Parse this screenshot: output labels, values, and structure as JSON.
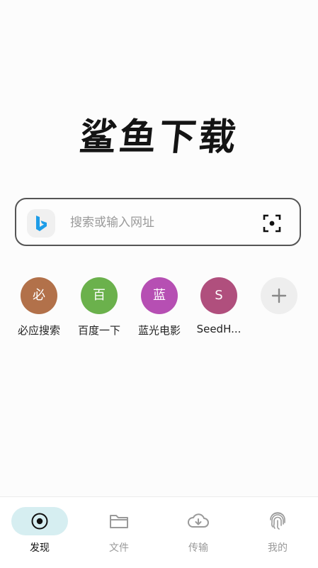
{
  "app": {
    "logo_text": "鲨鱼下载"
  },
  "search": {
    "placeholder": "搜索或输入网址",
    "engine_icon": "bing-icon",
    "scan_icon": "scan-icon"
  },
  "shortcuts": [
    {
      "initial": "必",
      "label": "必应搜索",
      "color": "#b2714a"
    },
    {
      "initial": "百",
      "label": "百度一下",
      "color": "#6bb14c"
    },
    {
      "initial": "蓝",
      "label": "蓝光电影",
      "color": "#b64fb3"
    },
    {
      "initial": "S",
      "label": "SeedH...",
      "color": "#b04f7d"
    }
  ],
  "add_shortcut": {
    "icon": "plus-icon",
    "color": "#eeeeee"
  },
  "nav": [
    {
      "label": "发现",
      "icon": "discover-icon",
      "active": true
    },
    {
      "label": "文件",
      "icon": "folder-icon",
      "active": false
    },
    {
      "label": "传输",
      "icon": "cloud-download-icon",
      "active": false
    },
    {
      "label": "我的",
      "icon": "fingerprint-icon",
      "active": false
    }
  ],
  "colors": {
    "active_nav_bg": "#d6eef1",
    "bing_blue": "#1e9de8"
  }
}
